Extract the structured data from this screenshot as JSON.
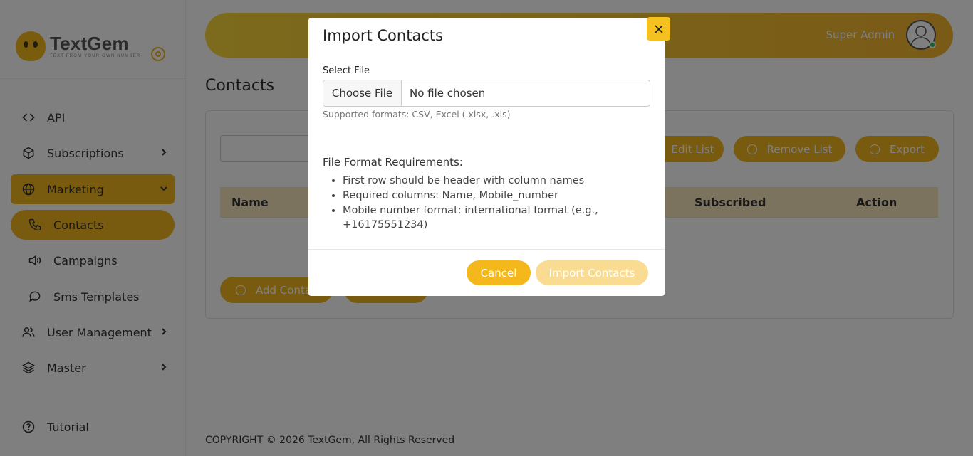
{
  "brand": {
    "name": "TextGem",
    "tagline": "TEXT FROM YOUR OWN NUMBER",
    "accent": "#f2b721"
  },
  "sidebar": {
    "items": [
      {
        "label": "API",
        "icon": "code-icon"
      },
      {
        "label": "Subscriptions",
        "icon": "package-icon"
      },
      {
        "label": "Marketing",
        "icon": "globe-icon"
      },
      {
        "label": "Contacts",
        "icon": "phone-icon"
      },
      {
        "label": "Campaigns",
        "icon": "megaphone-icon"
      },
      {
        "label": "Sms Templates",
        "icon": "chat-bubble-icon"
      },
      {
        "label": "User Management",
        "icon": "users-icon"
      },
      {
        "label": "Master",
        "icon": "layers-icon"
      },
      {
        "label": "Tutorial",
        "icon": "help-circle-icon"
      }
    ]
  },
  "header": {
    "user_name": "Super Admin"
  },
  "page": {
    "title": "Contacts",
    "buttons": {
      "edit_list": "Edit List",
      "remove_list": "Remove List",
      "export": "Export",
      "add_contact": "Add Conta"
    },
    "table": {
      "columns": [
        "Name",
        "Subscribed",
        "Action"
      ]
    }
  },
  "footer": {
    "copyright": "COPYRIGHT © 2026 TextGem, All Rights Reserved"
  },
  "modal": {
    "title": "Import Contacts",
    "field_label": "Select File",
    "file_button": "Choose File",
    "file_status": "No file chosen",
    "help": "Supported formats: CSV, Excel (.xlsx, .xls)",
    "requirements_title": "File Format Requirements:",
    "requirements": [
      "First row should be header with column names",
      "Required columns: Name, Mobile_number",
      "Mobile number format: international format (e.g., +16175551234)"
    ],
    "cancel": "Cancel",
    "import": "Import Contacts"
  }
}
